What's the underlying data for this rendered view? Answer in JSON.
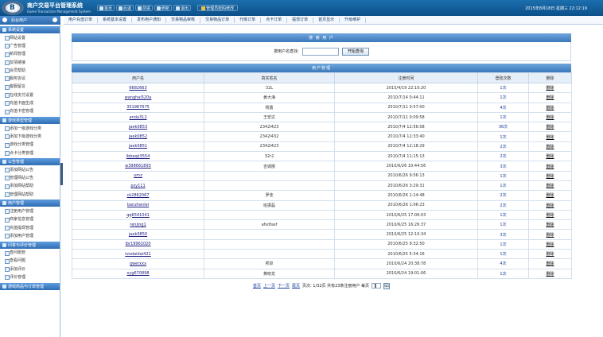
{
  "header": {
    "title": "商户交易平台管理系统",
    "subtitle": "Game Transaction Management System",
    "toolbar": [
      {
        "label": "首页"
      },
      {
        "label": "后退"
      },
      {
        "label": "前进"
      },
      {
        "label": "刷新"
      },
      {
        "label": "退出"
      }
    ],
    "password_button": "管理员密码修改",
    "datetime": "2015年8月18日  星期三  22:12:19"
  },
  "sidebar": {
    "caption": "后台用户",
    "sections": [
      {
        "title": "系统设置",
        "items": [
          "网站设置",
          "广告管理",
          "新闻管理",
          "友情链接",
          "会员帮助",
          "服务协议",
          "客服留言",
          "在线支付设置",
          "充值卡面生成",
          "充值卡密管理"
        ]
      },
      {
        "title": "游戏类型管理",
        "items": [
          "添加一级游戏分类",
          "添加下级游戏分类",
          "游戏分类管理",
          "点卡分类管理"
        ]
      },
      {
        "title": "公告管理",
        "items": [
          "添加网站公告",
          "管理网站公告",
          "添加网站帮助",
          "管理网站帮助"
        ]
      },
      {
        "title": "用户管理",
        "items": [
          "注册用户管理",
          "商家信息管理",
          "充值提现管理",
          "添加用户管理"
        ]
      },
      {
        "title": "问答与评价管理",
        "items": [
          "查问题管",
          "查看问题",
          "添加评价",
          "评价管理"
        ]
      },
      {
        "title": "游戏商品与订单管理",
        "items": []
      }
    ]
  },
  "topnav": [
    "用户充值订单",
    "系统基本设置",
    "发布用户通知",
    "交易物品审核",
    "交易物品订单",
    "代练订单",
    "点卡订单",
    "提现订单",
    "首页显示",
    "升级维护"
  ],
  "search": {
    "title": "搜 索 用 户",
    "label": "按用户名查找:",
    "value": "",
    "button": "开始查询"
  },
  "table": {
    "title": "用户管理",
    "headers": [
      "用户名",
      "真实姓名",
      "注册时间",
      "登陆次数",
      "删除"
    ],
    "rows": [
      [
        "6682663",
        "32L",
        "2015/4/19 22:10:20",
        "1次",
        "删除"
      ],
      [
        "wanghai520a",
        "姜大海",
        "2010/7/14 0:44:11",
        "1次",
        "删除"
      ],
      [
        "351987675",
        "杨勇",
        "2010/7/11 0:57:00",
        "4次",
        "删除"
      ],
      [
        "anda312",
        "王宏达",
        "2010/7/11 0:09:58",
        "1次",
        "删除"
      ],
      [
        "jaek0853",
        "2342l423",
        "2010/7/4 12:56:08",
        "36次",
        "删除"
      ],
      [
        "jaek0852",
        "2342l432",
        "2010/7/4 12:33:40",
        "1次",
        "删除"
      ],
      [
        "jaek0851",
        "2342l423",
        "2010/7/4 12:18:29",
        "2次",
        "删除"
      ],
      [
        "lbbaqk3554",
        "32r2",
        "2010/7/4 11:15:13",
        "2次",
        "删除"
      ],
      [
        "w398661893",
        "吉城丽",
        "2010/6/26 10:44:56",
        "3次",
        "删除"
      ],
      [
        "urnz",
        "",
        "2010/6/26 9:56:13",
        "1次",
        "删除"
      ],
      [
        "psy111",
        "",
        "2010/6/26 3:29:31",
        "1次",
        "删除"
      ],
      [
        "ck2862067",
        "罗佳",
        "2010/6/26 1:14:48",
        "2次",
        "删除"
      ],
      [
        "banzhenlei",
        "班振磊",
        "2010/6/26 1:06:23",
        "2次",
        "删除"
      ],
      [
        "qq6541041",
        "",
        "2010/6/25 17:06:03",
        "1次",
        "删除"
      ],
      [
        "renjing1",
        "afsdfasf",
        "2010/6/25 16:26:37",
        "1次",
        "删除"
      ],
      [
        "jaek0850",
        "",
        "2010/6/25 12:10:34",
        "3次",
        "删除"
      ],
      [
        "lbr19961020",
        "",
        "2010/6/25 9:32:50",
        "1次",
        "删除"
      ],
      [
        "tzodaidai421",
        "",
        "2010/6/25 5:34:16",
        "1次",
        "删除"
      ],
      [
        "qwerxxx",
        "邦泉",
        "2010/6/24 20:38:78",
        "4次",
        "删除"
      ],
      [
        "xyg670898",
        "黄晓龙",
        "2010/6/24 19:01:06",
        "1次",
        "删除"
      ]
    ]
  },
  "pager": {
    "first": "首页",
    "prev": "上一页",
    "next": "下一页",
    "last": "尾页",
    "info": "页次: 1/32页  共有23条注册用户  每页",
    "page_value": "1",
    "go": "Go"
  }
}
